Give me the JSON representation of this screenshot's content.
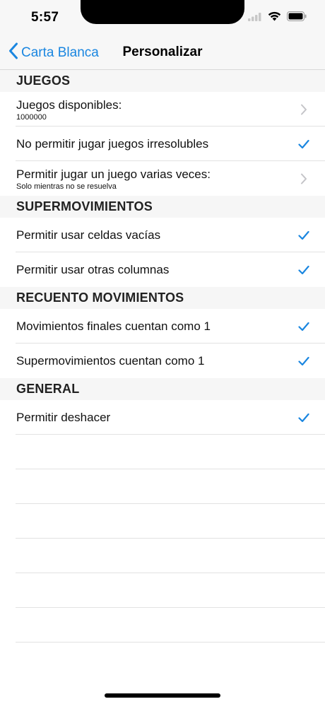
{
  "status_bar": {
    "time": "5:57"
  },
  "nav": {
    "back_label": "Carta Blanca",
    "title": "Personalizar"
  },
  "colors": {
    "accent": "#1a86e0",
    "section_bg": "#f6f6f6"
  },
  "sections": [
    {
      "header": "JUEGOS",
      "rows": [
        {
          "label": "Juegos disponibles:",
          "sublabel": "1000000",
          "accessory": "chevron-icon"
        },
        {
          "label": "No permitir jugar juegos irresolubles",
          "accessory": "checkmark-icon"
        },
        {
          "label": "Permitir jugar un juego varias veces:",
          "sublabel": "Solo mientras no se resuelva",
          "accessory": "chevron-icon"
        }
      ]
    },
    {
      "header": "SUPERMOVIMIENTOS",
      "rows": [
        {
          "label": "Permitir usar celdas vacías",
          "accessory": "checkmark-icon"
        },
        {
          "label": "Permitir usar otras columnas",
          "accessory": "checkmark-icon"
        }
      ]
    },
    {
      "header": "RECUENTO MOVIMIENTOS",
      "rows": [
        {
          "label": "Movimientos finales cuentan como 1",
          "accessory": "checkmark-icon"
        },
        {
          "label": "Supermovimientos cuentan como 1",
          "accessory": "checkmark-icon"
        }
      ]
    },
    {
      "header": "GENERAL",
      "rows": [
        {
          "label": "Permitir deshacer",
          "accessory": "checkmark-icon"
        }
      ]
    }
  ]
}
